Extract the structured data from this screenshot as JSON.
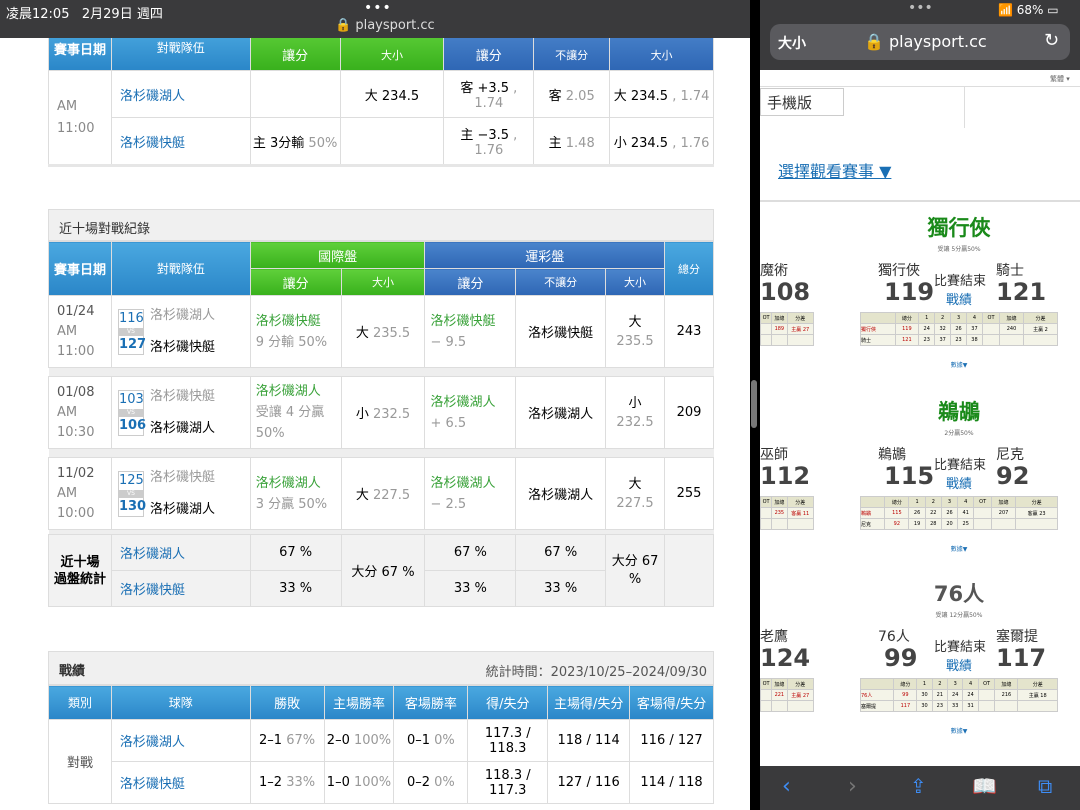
{
  "status": {
    "time": "凌晨12:05",
    "date": "2月29日 週四",
    "url": "playsport.cc",
    "battery": "68%"
  },
  "odds_table": {
    "headers": {
      "date": "賽事日期",
      "teams": "對戰隊伍",
      "handicap": "讓分",
      "total": "大小",
      "handicap2": "讓分",
      "no_handicap": "不讓分",
      "total2": "大小"
    },
    "time_am": "AM",
    "time_val": "11:00",
    "team1": "洛杉磯湖人",
    "team2": "洛杉磯快艇",
    "r1": {
      "intl_total": "大 234.5",
      "hc": "客 +3.5",
      "hc_odds": ", 1.74",
      "nh": "客",
      "nh_odds": "2.05",
      "tot": "大 234.5",
      "tot_odds": ", 1.74"
    },
    "r2": {
      "intl_hc": "主 3分輸",
      "intl_hc_pct": "50%",
      "hc": "主 −3.5",
      "hc_odds": ", 1.76",
      "nh": "主",
      "nh_odds": "1.48",
      "tot": "小 234.5",
      "tot_odds": ", 1.76"
    }
  },
  "h2h": {
    "title": "近十場對戰紀錄",
    "headers": {
      "date": "賽事日期",
      "teams": "對戰隊伍",
      "intl": "國際盤",
      "lottery": "運彩盤",
      "handicap": "讓分",
      "total": "大小",
      "handicap2": "讓分",
      "no_handicap": "不讓分",
      "total2": "大小",
      "total_score": "總分"
    },
    "rows": [
      {
        "date": "01/24",
        "ampm": "AM",
        "time": "11:00",
        "s1": "116",
        "t1": "洛杉磯湖人",
        "s2": "127",
        "t2": "洛杉磯快艇",
        "vs": "VS",
        "ih_team": "洛杉磯快艇",
        "ih_detail": "9 分輸 50%",
        "it": "大",
        "it_val": "235.5",
        "lh_team": "洛杉磯快艇",
        "lh_val": "− 9.5",
        "nh": "洛杉磯快艇",
        "lt": "大",
        "lt_val": "235.5",
        "sum": "243"
      },
      {
        "date": "01/08",
        "ampm": "AM",
        "time": "10:30",
        "s1": "103",
        "t1": "洛杉磯快艇",
        "s2": "106",
        "t2": "洛杉磯湖人",
        "vs": "VS",
        "ih_team": "洛杉磯湖人",
        "ih_detail": "受讓 4 分贏 50%",
        "it": "小",
        "it_val": "232.5",
        "lh_team": "洛杉磯湖人",
        "lh_val": "+ 6.5",
        "nh": "洛杉磯湖人",
        "lt": "小",
        "lt_val": "232.5",
        "sum": "209"
      },
      {
        "date": "11/02",
        "ampm": "AM",
        "time": "10:00",
        "s1": "125",
        "t1": "洛杉磯快艇",
        "s2": "130",
        "t2": "洛杉磯湖人",
        "vs": "VS",
        "ih_team": "洛杉磯湖人",
        "ih_detail": "3 分贏 50%",
        "it": "大",
        "it_val": "227.5",
        "lh_team": "洛杉磯湖人",
        "lh_val": "− 2.5",
        "nh": "洛杉磯湖人",
        "lt": "大",
        "lt_val": "227.5",
        "sum": "255"
      }
    ],
    "stats": {
      "label1": "近十場",
      "label2": "過盤統計",
      "team1": "洛杉磯湖人",
      "team2": "洛杉磯快艇",
      "ih1": "67 %",
      "ih2": "33 %",
      "it": "大分 67 %",
      "lh1": "67 %",
      "lh2": "33 %",
      "nh1": "67 %",
      "nh2": "33 %",
      "lt": "大分 67 %"
    }
  },
  "record": {
    "title": "戰績",
    "period": "統計時間：2023/10/25–2024/09/30",
    "headers": {
      "cat": "類別",
      "team": "球隊",
      "wl": "勝敗",
      "home_pct": "主場勝率",
      "away_pct": "客場勝率",
      "pts": "得/失分",
      "home_pts": "主場得/失分",
      "away_pts": "客場得/失分"
    },
    "cat": "對戰",
    "rows": [
      {
        "team": "洛杉磯湖人",
        "wl": "2–1",
        "wl_pct": "67%",
        "home": "2–0",
        "home_pct": "100%",
        "away": "0–1",
        "away_pct": "0%",
        "pts": "117.3 / 118.3",
        "hpts": "118 / 114",
        "apts": "116 / 127"
      },
      {
        "team": "洛杉磯快艇",
        "wl": "1–2",
        "wl_pct": "33%",
        "home": "1–0",
        "home_pct": "100%",
        "away": "0–2",
        "away_pct": "0%",
        "pts": "118.3 / 117.3",
        "hpts": "127 / 116",
        "apts": "114 / 118"
      }
    ]
  },
  "right": {
    "aa": "大小",
    "url": "playsport.cc",
    "tiny": "繁體 ▾",
    "mobile": "手機版",
    "select": "選擇觀看賽事 ▼",
    "games": [
      {
        "winner": "獨行俠",
        "sub": "受讓 5分贏50%",
        "home": "獨行俠",
        "away": "騎士",
        "hs": "119",
        "as": "121",
        "status": "比賽結束",
        "link": "戰績",
        "left_team": "魔術",
        "left_score": "108",
        "detail": "數據▼",
        "q_headers": [
          "總分",
          "1",
          "2",
          "3",
          "4",
          "OT",
          "加總",
          "分差"
        ],
        "r1": [
          "獨行俠",
          "119",
          "24",
          "32",
          "26",
          "37",
          "",
          "240",
          "主贏 2"
        ],
        "r2": [
          "騎士",
          "121",
          "23",
          "37",
          "23",
          "38",
          "",
          "",
          ""
        ],
        "lq": [
          "OT",
          "加總",
          "分差"
        ],
        "lv": [
          "",
          "189",
          "主贏 27"
        ]
      },
      {
        "winner": "鵜鶘",
        "sub": "2分贏50%",
        "home": "鵜鶘",
        "away": "尼克",
        "hs": "115",
        "as": "92",
        "status": "比賽結束",
        "link": "戰績",
        "left_team": "巫師",
        "left_score": "112",
        "detail": "數據▼",
        "q_headers": [
          "總分",
          "1",
          "2",
          "3",
          "4",
          "OT",
          "加總",
          "分差"
        ],
        "r1": [
          "鵜鶘",
          "115",
          "26",
          "22",
          "26",
          "41",
          "",
          "207",
          "客贏 23"
        ],
        "r2": [
          "尼克",
          "92",
          "19",
          "28",
          "20",
          "25",
          "",
          "",
          ""
        ],
        "lq": [
          "OT",
          "加總",
          "分差"
        ],
        "lv": [
          "",
          "235",
          "客贏 11"
        ]
      },
      {
        "winner": "76人",
        "sub": "受讓 12分贏50%",
        "home": "76人",
        "away": "塞爾提",
        "hs": "99",
        "as": "117",
        "status": "比賽結束",
        "link": "戰績",
        "left_team": "老鷹",
        "left_score": "124",
        "detail": "數據▼",
        "q_headers": [
          "總分",
          "1",
          "2",
          "3",
          "4",
          "OT",
          "加總",
          "分差"
        ],
        "r1": [
          "76人",
          "99",
          "30",
          "21",
          "24",
          "24",
          "",
          "216",
          "主贏 18"
        ],
        "r2": [
          "塞爾提",
          "117",
          "30",
          "23",
          "33",
          "31",
          "",
          "",
          ""
        ],
        "lq": [
          "OT",
          "加總",
          "分差"
        ],
        "lv": [
          "",
          "221",
          "主贏 27"
        ]
      }
    ]
  }
}
